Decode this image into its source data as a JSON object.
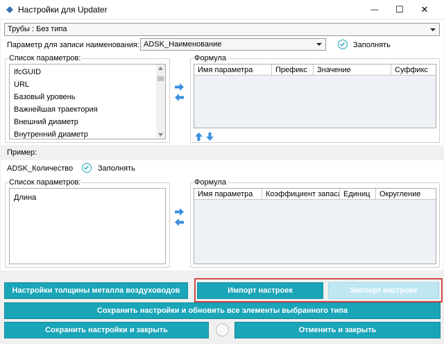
{
  "window": {
    "title": "Настройки для Updater",
    "minimize_glyph": "—",
    "maximize_glyph": "☐",
    "close_glyph": "✕"
  },
  "category_combo": {
    "value": "Трубы : Без типа"
  },
  "name_param": {
    "label": "Параметр для записи наименования:",
    "value": "ADSK_Наименование",
    "fill_label": "Заполнять"
  },
  "section1": {
    "params_legend": "Список параметров:",
    "params": [
      "IfcGUID",
      "URL",
      "Базовый уровень",
      "Важнейшая траектория",
      "Внешний диаметр",
      "Внутренний диаметр"
    ],
    "formula_legend": "Формула",
    "formula_columns": [
      "Имя параметра",
      "Префикс",
      "Значение",
      "Суффикс"
    ]
  },
  "example": {
    "label": "Пример:"
  },
  "quantity_param": {
    "label": "ADSK_Количество",
    "fill_label": "Заполнять"
  },
  "section2": {
    "params_legend": "Список параметров:",
    "params": [
      "Длина"
    ],
    "formula_legend": "Формула",
    "formula_columns": [
      "Имя параметра",
      "Коэффициент запаса",
      "Единиц",
      "Округление"
    ]
  },
  "buttons": {
    "metal_thickness": "Настройки толщины металла воздуховодов",
    "import": "Импорт настроек",
    "export": "Экспорт настроек",
    "save_update": "Сохранить настройки и обновить все элементы выбранного типа",
    "save_close": "Сохранить настройки и закрыть",
    "cancel_close": "Отменить и закрыть"
  },
  "colors": {
    "accent": "#1aa5b8",
    "disabled": "#bfe8f3",
    "highlight_frame": "#d64a4a",
    "arrow_blue": "#3a8fe0"
  }
}
